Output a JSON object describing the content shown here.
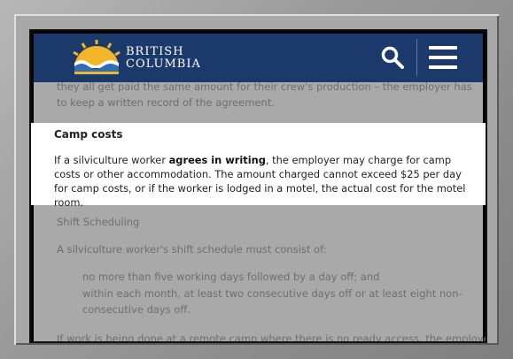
{
  "header": {
    "logo_line1": "BRITISH",
    "logo_line2": "COLUMBIA",
    "colors": {
      "header_bg": "#1b3a6b",
      "sun": "#f3b52a"
    }
  },
  "content": {
    "top_paragraph": "they all get paid the same amount for their crew's production – the employer has to keep a written record of the agreement.",
    "camp_costs": {
      "heading": "Camp costs",
      "text_before_bold": "If a silviculture worker ",
      "bold": "agrees in writing",
      "text_after_bold": ", the employer may charge for camp costs or other accommodation. The amount charged cannot exceed $25 per day for camp costs, or if the worker is lodged in a motel, the actual cost for the motel room."
    },
    "shift_heading": "Shift Scheduling",
    "shift_intro": "A silviculture worker's shift schedule must consist of:",
    "shift_items": [
      "no more than five working days followed by a day off; and",
      "within each month, at least two consecutive days off or at least eight non-consecutive days off."
    ],
    "bottom_paragraph": "If work is being done at a remote camp where there is no ready access, the employer may"
  },
  "icons": {
    "search": "search-icon",
    "menu": "hamburger-menu-icon",
    "logo": "bc-sun-logo-icon"
  }
}
